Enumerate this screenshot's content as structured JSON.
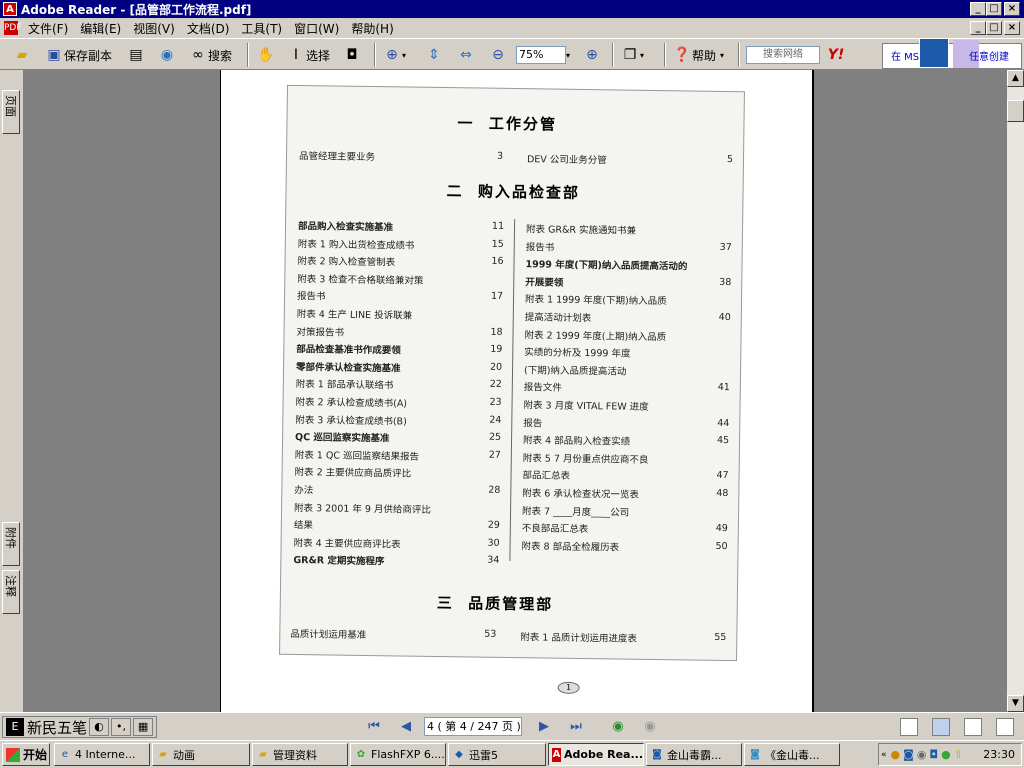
{
  "window": {
    "title": "Adobe Reader - [品管部工作流程.pdf]"
  },
  "menu": [
    "文件(F)",
    "编辑(E)",
    "视图(V)",
    "文档(D)",
    "工具(T)",
    "窗口(W)",
    "帮助(H)"
  ],
  "toolbar": {
    "save_copy": "保存副本",
    "search": "搜索",
    "select": "选择",
    "zoom": "75%",
    "help": "帮助",
    "search_web_placeholder": "搜索网络",
    "right_panel_text": "在 MS",
    "right_panel_text2": "任意创建"
  },
  "left_tabs": [
    "页面",
    "附件",
    "注释"
  ],
  "document": {
    "sections": [
      {
        "num": "一",
        "title": "工作分管"
      },
      {
        "num": "二",
        "title": "购入品检查部"
      },
      {
        "num": "三",
        "title": "品质管理部"
      }
    ],
    "sec1": [
      {
        "t": "品管经理主要业务",
        "p": "3"
      },
      {
        "t": "DEV 公司业务分管",
        "p": "5"
      }
    ],
    "sec2_left": [
      {
        "t": "部品购入检查实施基准",
        "p": "11",
        "b": true
      },
      {
        "t": "附表 1   购入出货检查成绩书",
        "p": "15"
      },
      {
        "t": "附表 2   购入检查管制表",
        "p": "16"
      },
      {
        "t": "附表 3   检查不合格联络兼对策",
        "p": ""
      },
      {
        "t": "报告书",
        "p": "17"
      },
      {
        "t": "附表 4   生产 LINE 投诉联兼",
        "p": ""
      },
      {
        "t": "对策报告书",
        "p": "18"
      },
      {
        "t": "部品检查基准书作成要领",
        "p": "19",
        "b": true
      },
      {
        "t": "零部件承认检查实施基准",
        "p": "20",
        "b": true
      },
      {
        "t": "附表 1   部品承认联络书",
        "p": "22"
      },
      {
        "t": "附表 2   承认检查成绩书(A)",
        "p": "23"
      },
      {
        "t": "附表 3   承认检查成绩书(B)",
        "p": "24"
      },
      {
        "t": "QC 巡回监察实施基准",
        "p": "25",
        "b": true
      },
      {
        "t": "附表 1   QC 巡回监察结果报告",
        "p": "27"
      },
      {
        "t": "附表 2   主要供应商品质评比",
        "p": ""
      },
      {
        "t": "办法",
        "p": "28"
      },
      {
        "t": "附表 3   2001 年 9 月供给商评比",
        "p": ""
      },
      {
        "t": "结果",
        "p": "29"
      },
      {
        "t": "附表 4   主要供应商评比表",
        "p": "30"
      },
      {
        "t": "GR&R 定期实施程序",
        "p": "34",
        "b": true
      }
    ],
    "sec2_right": [
      {
        "t": "附表    GR&R 实施通知书兼",
        "p": ""
      },
      {
        "t": "报告书",
        "p": "37"
      },
      {
        "t": "1999 年度(下期)纳入品质提高活动的",
        "p": "",
        "b": true
      },
      {
        "t": "开展要领",
        "p": "38",
        "b": true
      },
      {
        "t": "附表 1   1999 年度(下期)纳入品质",
        "p": ""
      },
      {
        "t": "提高活动计划表",
        "p": "40"
      },
      {
        "t": "附表 2   1999 年度(上期)纳入品质",
        "p": ""
      },
      {
        "t": "实绩的分析及 1999 年度",
        "p": ""
      },
      {
        "t": "(下期)纳入品质提高活动",
        "p": ""
      },
      {
        "t": "报告文件",
        "p": "41"
      },
      {
        "t": "附表 3   月度 VITAL FEW 进度",
        "p": ""
      },
      {
        "t": "报告",
        "p": "44"
      },
      {
        "t": "附表 4   部品购入检查实绩",
        "p": "45"
      },
      {
        "t": "附表 5   7 月份重点供应商不良",
        "p": ""
      },
      {
        "t": "部品汇总表",
        "p": "47"
      },
      {
        "t": "附表 6   承认检查状况一览表",
        "p": "48"
      },
      {
        "t": "附表 7   ____月度____公司",
        "p": ""
      },
      {
        "t": "不良部品汇总表",
        "p": "49"
      },
      {
        "t": "附表 8   部品全检履历表",
        "p": "50"
      }
    ],
    "sec3": [
      {
        "t": "品质计划运用基准",
        "p": "53"
      },
      {
        "t": "附表 1   品质计划运用进度表",
        "p": "55"
      }
    ],
    "page_badge": "1"
  },
  "statusbar": {
    "ime_name": "新民五笔",
    "page_indicator": "4 ( 第 4 / 247 页 )"
  },
  "taskbar": {
    "start": "开始",
    "tasks": [
      "4 Interne...",
      "动画",
      "管理资料",
      "FlashFXP 6....",
      "迅雷5",
      "Adobe Rea...",
      "金山毒霸...",
      "《金山毒..."
    ],
    "clock": "23:30"
  }
}
